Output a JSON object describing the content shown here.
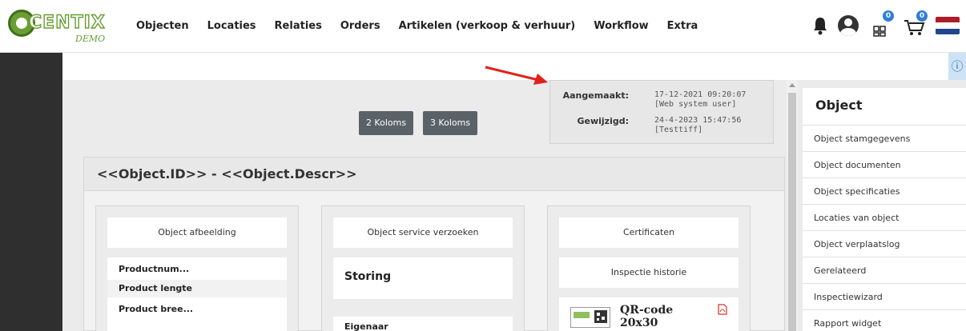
{
  "app": {
    "logo_text": "CENTIX",
    "logo_sub": "DEMO"
  },
  "nav": {
    "items": [
      "Objecten",
      "Locaties",
      "Relaties",
      "Orders",
      "Artikelen (verkoop & verhuur)",
      "Workflow",
      "Extra"
    ]
  },
  "header_icons": {
    "list_badge": "0",
    "cart_badge": "0"
  },
  "meta": {
    "created_label": "Aangemaakt:",
    "created_value": "17-12-2021 09:20:07",
    "created_by": "[Web system user]",
    "modified_label": "Gewijzigd:",
    "modified_value": "24-4-2023 15:47:56",
    "modified_by": "[Testtiff]"
  },
  "layout_buttons": {
    "two_cols": "2 Koloms",
    "three_cols": "3 Koloms"
  },
  "object": {
    "title": "<<Object.ID>> - <<Object.Descr>>",
    "col1": {
      "header": "Object afbeelding",
      "rows": [
        "Productnum...",
        "Product lengte",
        "Product bree..."
      ]
    },
    "col2": {
      "header": "Object service verzoeken",
      "status": "Storing",
      "owner_label": "Eigenaar"
    },
    "col3": {
      "header": "Certificaten",
      "history": "Inspectie historie",
      "qr_title": "QR-code 20x30"
    }
  },
  "sidebar": {
    "title": "Object",
    "items": [
      "Object stamgegevens",
      "Object documenten",
      "Object specificaties",
      "Locaties van object",
      "Object verplaatslog",
      "Gerelateerd",
      "Inspectiewizard",
      "Rapport widget"
    ]
  },
  "colors": {
    "brand_green": "#6a9d33",
    "nav_dark": "#2f2f2f",
    "button_gray": "#5a6268",
    "badge_blue": "#2f7ed8",
    "arrow_red": "#e0221c"
  }
}
